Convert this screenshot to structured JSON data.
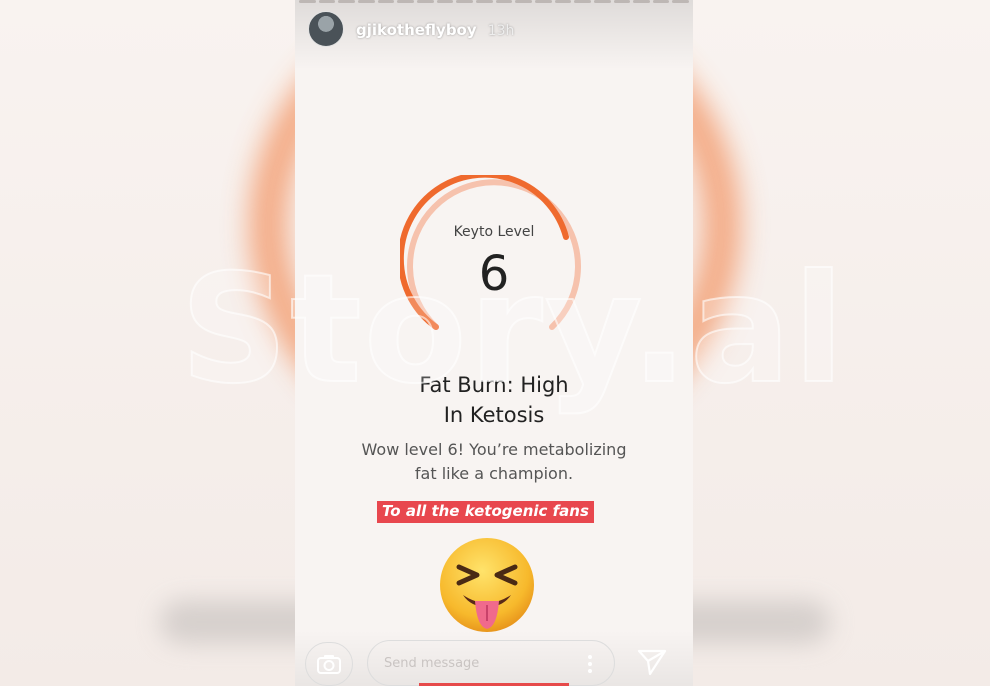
{
  "story": {
    "username": "gjikotheflyboy",
    "time": "13h",
    "gauge": {
      "label": "Keyto Level",
      "value": "6",
      "level": 6,
      "accent": "#ef6a2e",
      "accent_light": "#f6b9a2"
    },
    "status_line1": "Fat Burn: High",
    "status_line2": "In Ketosis",
    "desc_line1": "Wow level 6! You’re metabolizing",
    "desc_line2": "fat like a champion.",
    "sticker": "To all the ketogenic fans",
    "emoji": "squinting-face-with-tongue"
  },
  "footer": {
    "message_placeholder": "Send message"
  },
  "watermark": "Story.al",
  "icons": {
    "camera": "camera-icon",
    "more": "more-vertical-icon",
    "send": "send-icon"
  }
}
